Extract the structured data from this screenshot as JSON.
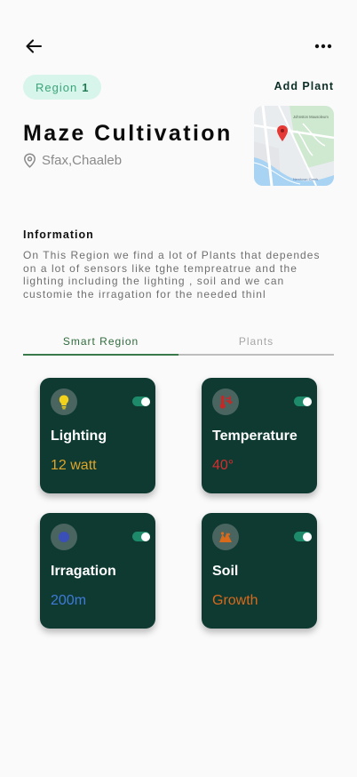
{
  "header": {
    "back_icon": "arrow-left-icon",
    "more_icon": "more-horizontal-icon"
  },
  "region": {
    "label": "Region",
    "number": "1"
  },
  "add_plant_label": "Add Plant",
  "title": "Maze Cultivation",
  "location": {
    "icon": "location-pin-icon",
    "text": "Sfax,Chaaleb"
  },
  "map": {
    "label": "Johnston Mausoleum",
    "road_label": "Newtown Creek"
  },
  "information": {
    "heading": "Information",
    "body": "On This Region we find a lot of Plants that dependes on a lot of sensors like tghe tempreatrue and the lighting including the lighting  , soil and we can customie the irragation for the needed thinl"
  },
  "tabs": [
    {
      "label": "Smart Region",
      "active": true
    },
    {
      "label": "Plants",
      "active": false
    }
  ],
  "cards": [
    {
      "label": "Lighting",
      "value": "12 watt",
      "icon": "lightbulb-icon",
      "value_color": "#e0a428",
      "icon_color": "#f2d21b",
      "toggle_on": true
    },
    {
      "label": "Temperature",
      "value": "40°",
      "icon": "thermometer-icon",
      "value_color": "#d32f2f",
      "icon_color": "#c62828",
      "toggle_on": true
    },
    {
      "label": "Irragation",
      "value": "200m",
      "icon": "water-drop-icon",
      "value_color": "#3f7bd8",
      "icon_color": "#3a4fb8",
      "toggle_on": true
    },
    {
      "label": "Soil",
      "value": "Growth",
      "icon": "soil-icon",
      "value_color": "#d86a1c",
      "icon_color": "#d86a1c",
      "toggle_on": true
    }
  ],
  "colors": {
    "card_bg": "#0e3a32",
    "accent_green": "#3a7a4a",
    "chip_bg": "#d7f5ea"
  }
}
